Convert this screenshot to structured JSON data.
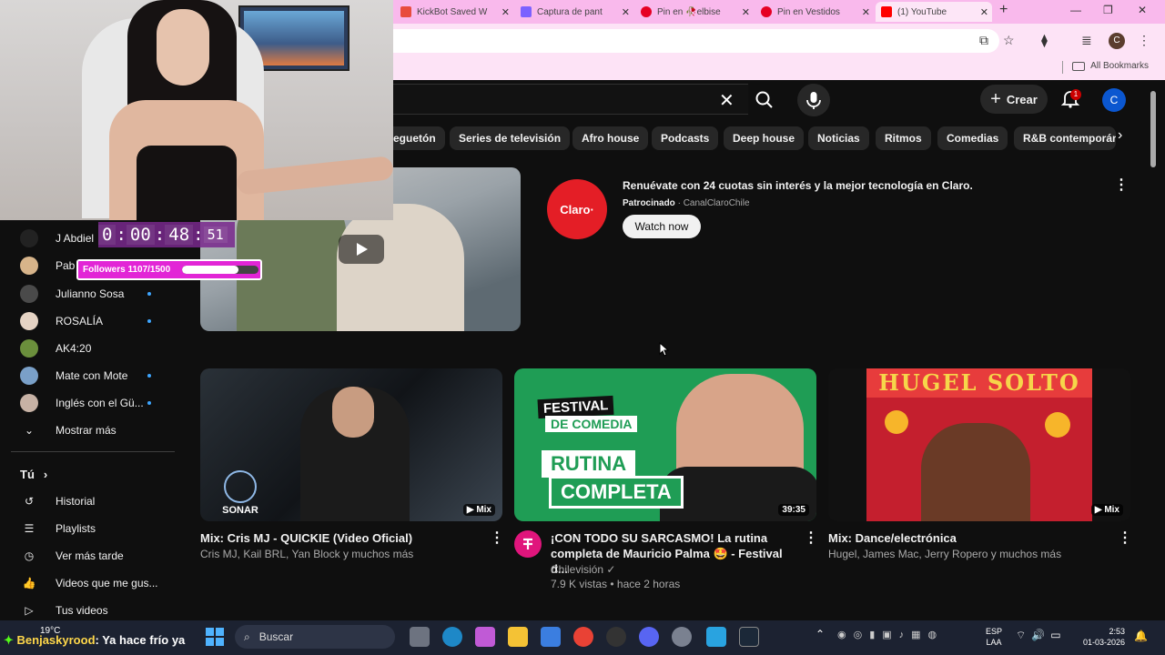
{
  "browser": {
    "tabs": [
      {
        "label": "KickBot Saved W",
        "favicon_color": "#e84c3d"
      },
      {
        "label": "Captura de pant",
        "favicon_color": "#7b61ff"
      },
      {
        "label": "Pin en 🥀elbise",
        "favicon_color": "#e60023"
      },
      {
        "label": "Pin en Vestidos",
        "favicon_color": "#e60023"
      },
      {
        "label": "(1) YouTube",
        "favicon_color": "#ff0000"
      }
    ],
    "new_tab": "+",
    "profile_initial": "C",
    "bookmarks_all": "All Bookmarks"
  },
  "youtube": {
    "create_label": "Crear",
    "notification_count": "1",
    "avatar_initial": "C",
    "chips": [
      "eguetón",
      "Series de televisión",
      "Afro house",
      "Podcasts",
      "Deep house",
      "Noticias",
      "Ritmos",
      "Comedias",
      "R&B contemporáne"
    ],
    "ad": {
      "logo_text": "Claro·",
      "title": "Renuévate con 24 cuotas sin interés y la mejor tecnología en Claro.",
      "sponsored": "Patrocinado",
      "channel": "CanalClaroChile",
      "cta": "Watch now"
    },
    "videos": [
      {
        "title": "Mix: Cris MJ - QUICKIE (Video Oficial)",
        "meta": "Cris MJ, Kail BRL, Yan Block y muchos más",
        "badge": "Mix",
        "thumb_text": "SONAR"
      },
      {
        "title_line1": "¡CON TODO SU SARCASMO! La rutina",
        "title_line2": "completa de Mauricio Palma 🤩 - Festival d...",
        "channel": "Chilevisión",
        "stats": "7.9 K vistas • hace 2 horas",
        "duration": "39:35",
        "thumb_fest": "FESTIVAL",
        "thumb_comedia": "DE COMEDIA",
        "thumb_r1": "RUTINA",
        "thumb_r2": "COMPLETA"
      },
      {
        "title": "Mix: Dance/electrónica",
        "meta": "Hugel, James Mac, Jerry Ropero y muchos más",
        "badge": "Mix",
        "thumb_text": "HUGEL SOLTO"
      }
    ]
  },
  "sidebar": {
    "subscriptions": [
      {
        "name": "J Abdiel",
        "color": "#222222",
        "dot": false
      },
      {
        "name": "Pab",
        "color": "#d7b48a",
        "dot": false
      },
      {
        "name": "Julianno Sosa",
        "color": "#4a4a4a",
        "dot": true
      },
      {
        "name": "ROSALÍA",
        "color": "#e5d3c4",
        "dot": true
      },
      {
        "name": "AK4:20",
        "color": "#6b8f3c",
        "dot": false
      },
      {
        "name": "Mate con Mote",
        "color": "#7aa0c8",
        "dot": true
      },
      {
        "name": "Inglés con el Gü...",
        "color": "#c7b2a5",
        "dot": true
      }
    ],
    "show_more": "Mostrar más",
    "you_section": "Tú",
    "you_items": [
      "Historial",
      "Playlists",
      "Ver más tarde",
      "Videos que me gus...",
      "Tus videos"
    ]
  },
  "stream": {
    "timer": [
      "0",
      "00",
      "48",
      "51"
    ],
    "followers_label": "Followers 1107/1500",
    "followers_progress": 0.738,
    "chat_user": "Benjaskyrood",
    "chat_message": ": Ya hace frío ya"
  },
  "taskbar": {
    "weather": "19°C",
    "search_placeholder": "Buscar",
    "lang_line1": "ESP",
    "lang_line2": "LAA",
    "time": "2:53",
    "date": "01-03-2026"
  }
}
